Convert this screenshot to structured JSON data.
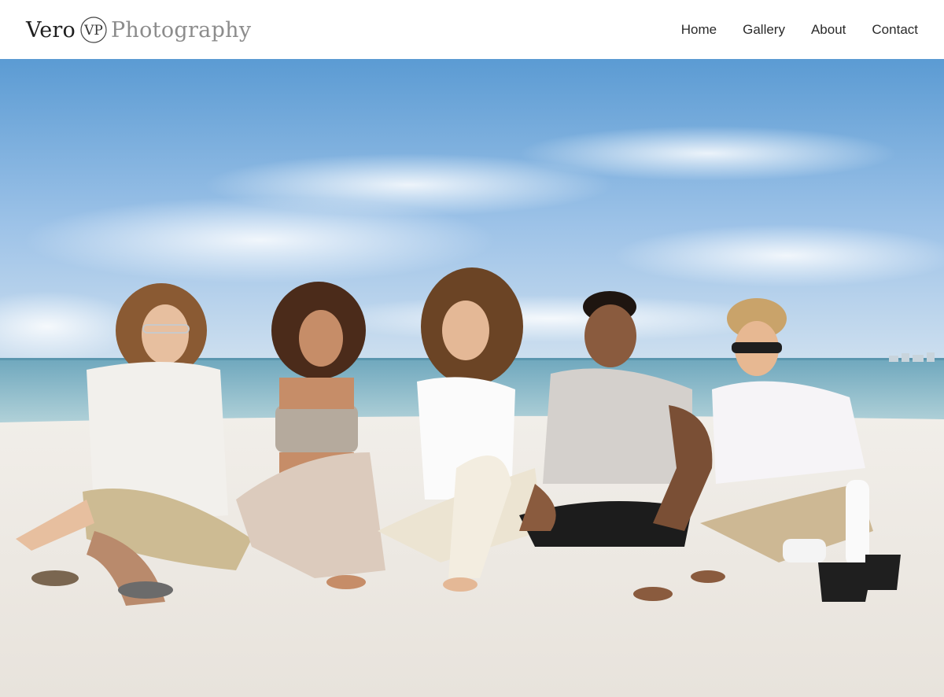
{
  "brand": {
    "name_left": "Vero",
    "monogram": "VP",
    "name_right": "Photography"
  },
  "nav": {
    "items": [
      {
        "label": "Home"
      },
      {
        "label": "Gallery"
      },
      {
        "label": "About"
      },
      {
        "label": "Contact"
      }
    ]
  },
  "hero": {
    "photo_subject": "beach-family-portrait-icon",
    "colors": {
      "sky_top": "#5f9fd6",
      "sky_mid": "#9fc4e8",
      "sea": "#7fb3c4",
      "sand": "#eeeae4"
    }
  }
}
